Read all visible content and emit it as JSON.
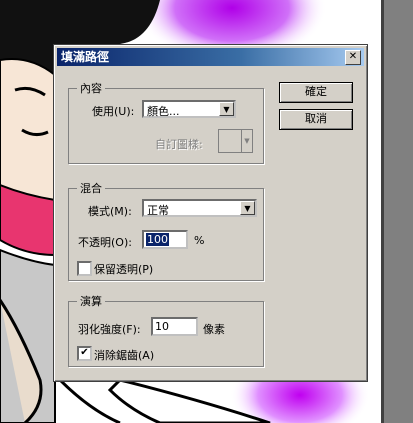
{
  "dialog": {
    "title": "填滿路徑",
    "close_glyph": "✕",
    "ok_label": "確定",
    "cancel_label": "取消"
  },
  "contents": {
    "legend": "內容",
    "use_label": "使用(U):",
    "use_value": "顏色...",
    "custom_pattern_label": "自訂圖樣:"
  },
  "blending": {
    "legend": "混合",
    "mode_label": "模式(M):",
    "mode_value": "正常",
    "opacity_label": "不透明(O):",
    "opacity_value": "100",
    "opacity_unit": "%",
    "preserve_transparency_label": "保留透明(P)",
    "preserve_transparency_checked": false
  },
  "rendering": {
    "legend": "演算",
    "feather_label": "羽化強度(F):",
    "feather_value": "10",
    "feather_unit": "像素",
    "antialias_label": "消除鋸齒(A)",
    "antialias_checked": true
  },
  "colors": {
    "titlebar_start": "#0a246a",
    "dialog_bg": "#d4d0c8",
    "background_glow": "#c21cf0"
  }
}
